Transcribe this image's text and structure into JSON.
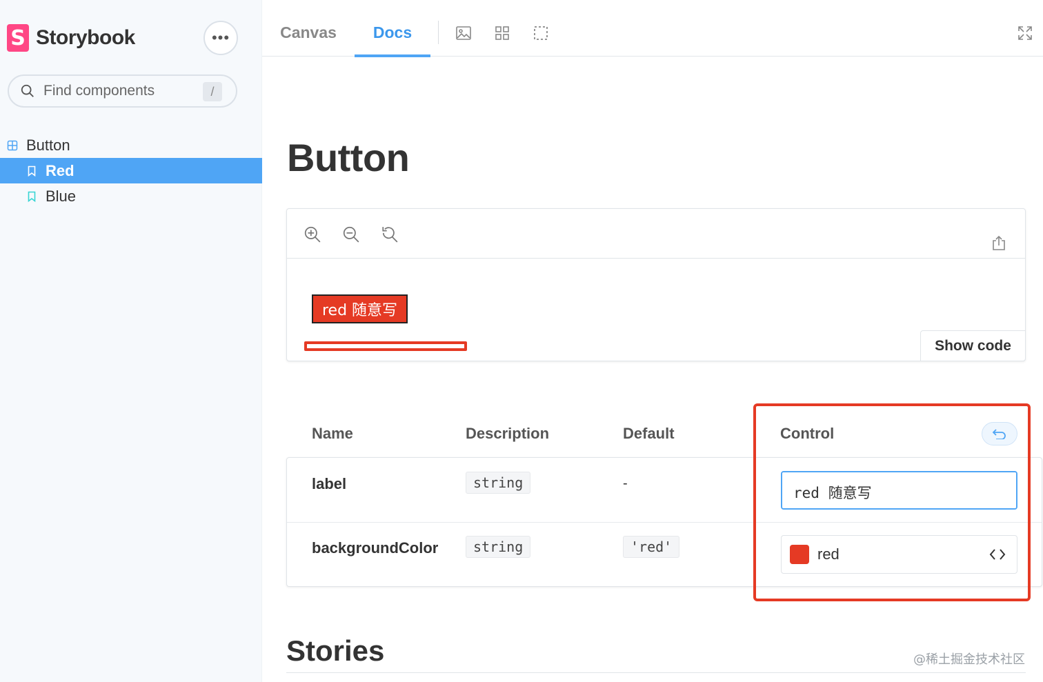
{
  "sidebar": {
    "brand": {
      "logo_letter": "S",
      "name": "Storybook"
    },
    "menu_label": "•••",
    "search": {
      "placeholder": "Find components",
      "shortcut": "/"
    },
    "tree": {
      "group_label": "Button",
      "stories": [
        {
          "label": "Red",
          "selected": true
        },
        {
          "label": "Blue",
          "selected": false
        }
      ]
    }
  },
  "toolbar": {
    "tabs": [
      {
        "label": "Canvas",
        "active": false
      },
      {
        "label": "Docs",
        "active": true
      }
    ],
    "icons": [
      "image-icon",
      "grid-icon",
      "outline-icon",
      "fullscreen-icon"
    ]
  },
  "docs": {
    "title": "Button",
    "preview": {
      "toolbar_icons": [
        "zoom-in-icon",
        "zoom-out-icon",
        "zoom-reset-icon",
        "share-icon"
      ],
      "demo_button_label": "red 随意写",
      "show_code_label": "Show code"
    },
    "args_table": {
      "headers": {
        "name": "Name",
        "description": "Description",
        "default": "Default",
        "control": "Control"
      },
      "rows": [
        {
          "name": "label",
          "type": "string",
          "default": "-",
          "control_value": "red 随意写"
        },
        {
          "name": "backgroundColor",
          "type": "string",
          "default": "'red'",
          "control_value": "red",
          "swatch_color": "#e53a24"
        }
      ]
    },
    "stories_heading": "Stories"
  },
  "watermark": "@稀土掘金技术社区",
  "colors": {
    "accent": "#4fa5f5",
    "brand": "#ff4785",
    "annotation": "#e53a24"
  }
}
